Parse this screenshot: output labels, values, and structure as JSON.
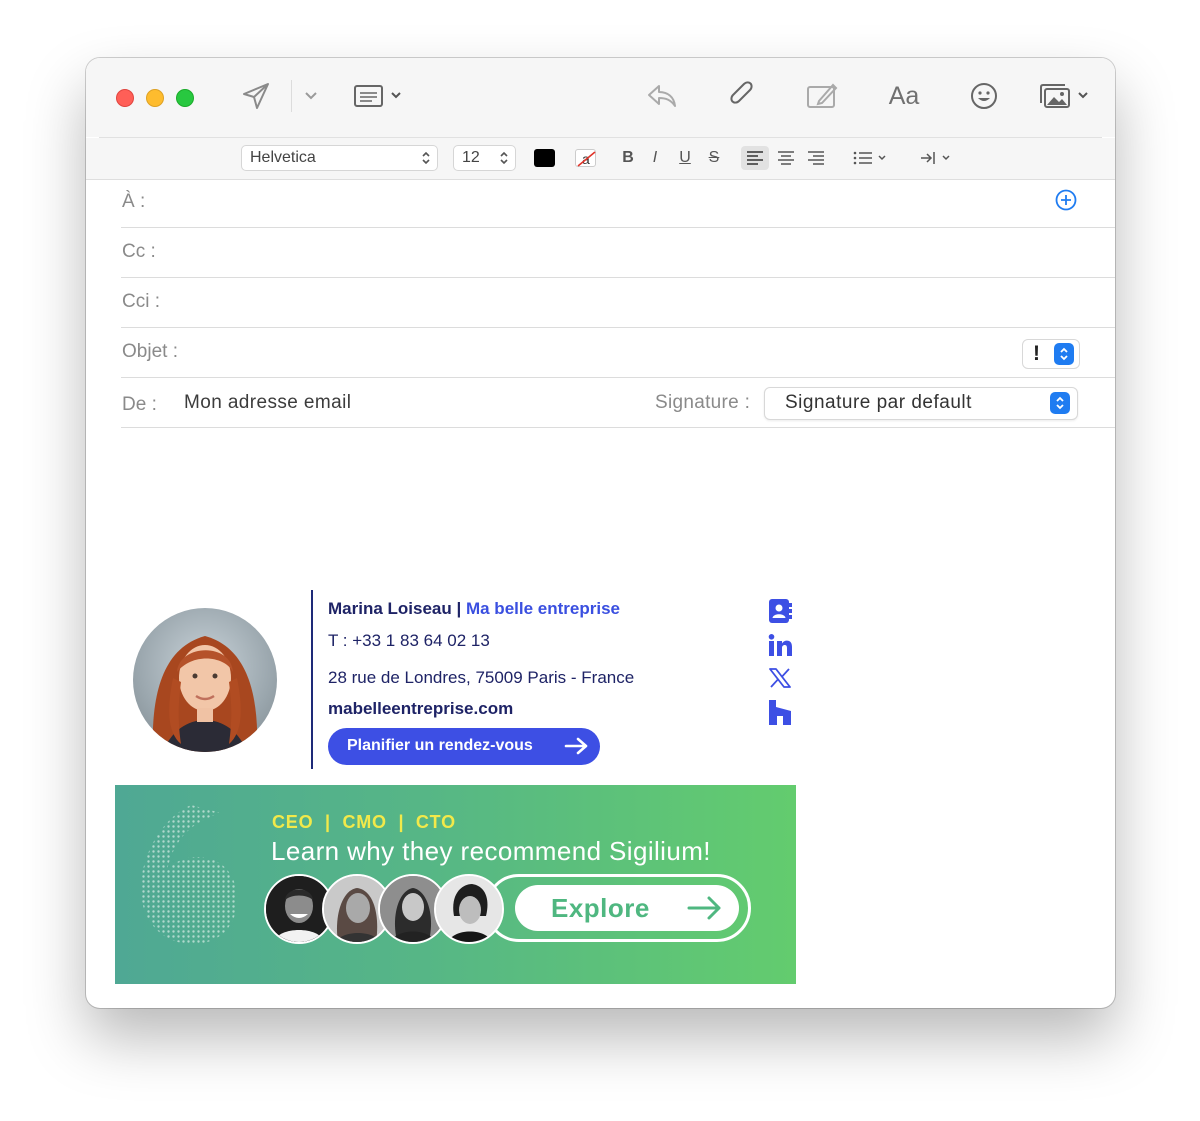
{
  "toolbar": {
    "font_name": "Helvetica",
    "font_size": "12",
    "format_aa": "Aa",
    "bold": "B",
    "italic": "I",
    "underline": "U",
    "strike": "S",
    "icons": [
      "send-icon",
      "chevron-down-icon",
      "header-fields-icon",
      "reply-icon",
      "paperclip-icon",
      "markup-icon",
      "emoji-icon",
      "photo-browser-icon"
    ]
  },
  "fields": {
    "to_label": "À :",
    "cc_label": "Cc :",
    "bcc_label": "Cci :",
    "subject_label": "Objet :",
    "priority_symbol": "!",
    "from_label": "De :",
    "from_value": "Mon adresse email",
    "signature_label": "Signature :",
    "signature_value": "Signature par default"
  },
  "signature": {
    "name": "Marina Loiseau | ",
    "company": "Ma belle entreprise",
    "phone": "T : +33 1 83 64 02 13",
    "address": "28 rue de Londres, 75009 Paris - France",
    "website": "mabelleentreprise.com",
    "cta_label": "Planifier un rendez-vous",
    "social_icons": [
      "contact-card-icon",
      "linkedin-icon",
      "x-icon",
      "houzz-icon"
    ],
    "accent_color": "#3d4fe4",
    "text_color": "#1e2366"
  },
  "banner": {
    "roles": "CEO  |  CMO  |  CTO",
    "headline": "Learn why they recommend Sigilium!",
    "button_label": "Explore",
    "gradient": [
      "#4fa894",
      "#63cc6e"
    ],
    "roles_color": "#f2e94a"
  }
}
